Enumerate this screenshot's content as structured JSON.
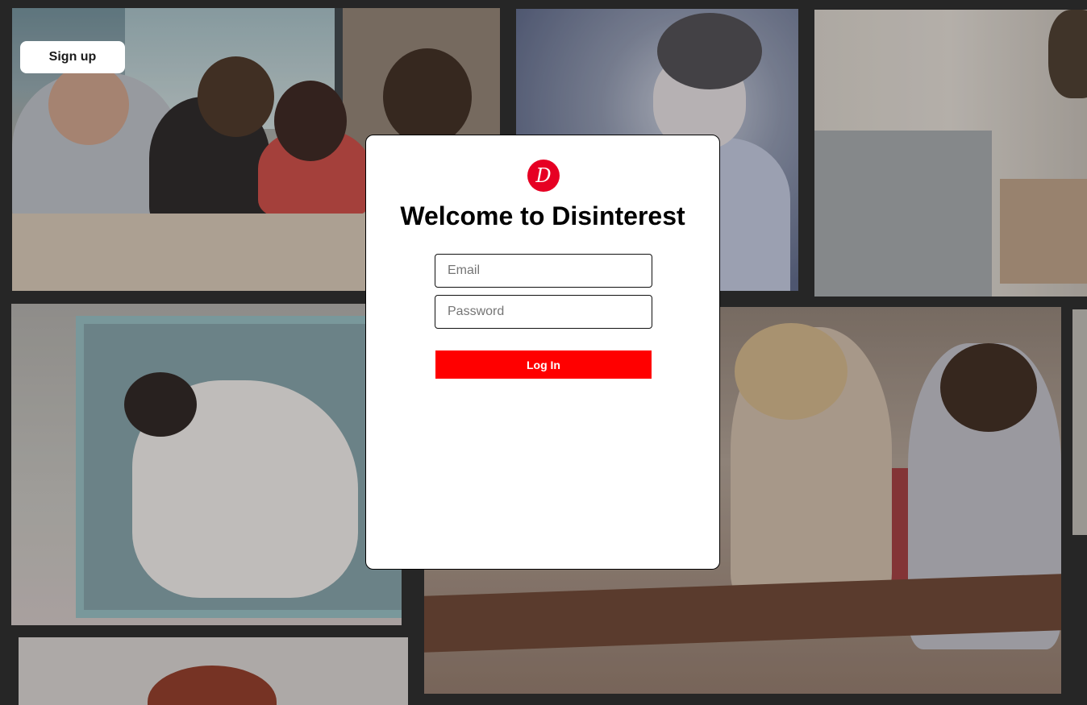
{
  "background": {
    "photos": [
      {
        "name": "office-meeting-photo"
      },
      {
        "name": "bored-boy-photo"
      },
      {
        "name": "laptop-photo"
      },
      {
        "name": "sleeping-toddler-photo"
      },
      {
        "name": "lecture-hall-photo"
      },
      {
        "name": "partial-photo"
      },
      {
        "name": "red-haired-woman-photo"
      }
    ]
  },
  "header": {
    "signup_label": "Sign up"
  },
  "modal": {
    "logo_icon": "disinterest-logo-icon",
    "logo_letter": "D",
    "title": "Welcome to Disinterest",
    "email_placeholder": "Email",
    "email_value": "",
    "password_placeholder": "Password",
    "password_value": "",
    "login_label": "Log In"
  },
  "colors": {
    "accent": "#ff0000",
    "logo_red": "#e60023",
    "page_background": "#262626",
    "modal_background": "#ffffff"
  }
}
